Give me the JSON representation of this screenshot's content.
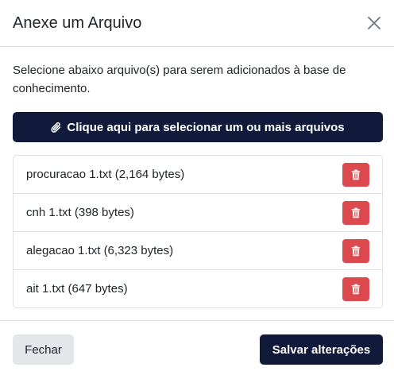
{
  "header": {
    "title": "Anexe um Arquivo",
    "close_icon": "close-icon"
  },
  "body": {
    "intro": "Selecione abaixo arquivo(s) para serem adicionados à base de conhecimento.",
    "select_button": {
      "icon": "paperclip-icon",
      "label": "Clique aqui para selecionar um ou mais arquivos"
    },
    "files": [
      {
        "name": "procuracao 1.txt (2,164 bytes)",
        "delete_icon": "trash-icon"
      },
      {
        "name": "cnh 1.txt (398 bytes)",
        "delete_icon": "trash-icon"
      },
      {
        "name": "alegacao 1.txt (6,323 bytes)",
        "delete_icon": "trash-icon"
      },
      {
        "name": "ait 1.txt (647 bytes)",
        "delete_icon": "trash-icon"
      }
    ]
  },
  "footer": {
    "close_label": "Fechar",
    "save_label": "Salvar alterações"
  },
  "colors": {
    "primary": "#111a3b",
    "danger": "#dc4a4f",
    "secondary": "#e4e6e9",
    "border": "#dee2e6"
  }
}
